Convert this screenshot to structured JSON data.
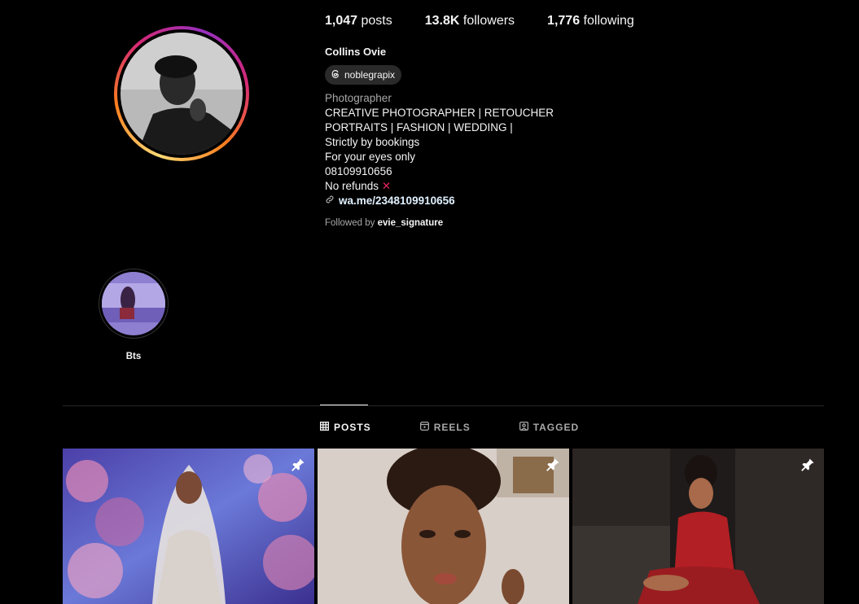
{
  "profile": {
    "posts_count": "1,047",
    "posts_label": "posts",
    "followers_count": "13.8K",
    "followers_label": "followers",
    "following_count": "1,776",
    "following_label": "following",
    "name": "Collins Ovie",
    "threads_handle": "noblegrapix",
    "category": "Photographer",
    "bio_lines": [
      "CREATIVE PHOTOGRAPHER | RETOUCHER",
      "PORTRAITS | FASHION | WEDDING |",
      "Strictly by bookings",
      "For your eyes only",
      "08109910656",
      "No refunds"
    ],
    "link": "wa.me/2348109910656",
    "followed_by_prefix": "Followed by",
    "followed_by_user": "evie_signature"
  },
  "highlights": [
    {
      "label": "Bts"
    }
  ],
  "tabs": [
    {
      "label": "POSTS",
      "icon": "grid-icon",
      "active": true
    },
    {
      "label": "REELS",
      "icon": "reels-icon",
      "active": false
    },
    {
      "label": "TAGGED",
      "icon": "tagged-icon",
      "active": false
    }
  ],
  "posts": [
    {
      "pinned": true,
      "icon": "pin-icon"
    },
    {
      "pinned": true,
      "icon": "pin-icon"
    },
    {
      "pinned": true,
      "icon": "pin-icon"
    }
  ],
  "colors": {
    "background": "#000000",
    "text": "#f5f5f5",
    "muted": "#a8a8a8",
    "link": "#e0f1ff",
    "refund_x": "#e0245e"
  }
}
